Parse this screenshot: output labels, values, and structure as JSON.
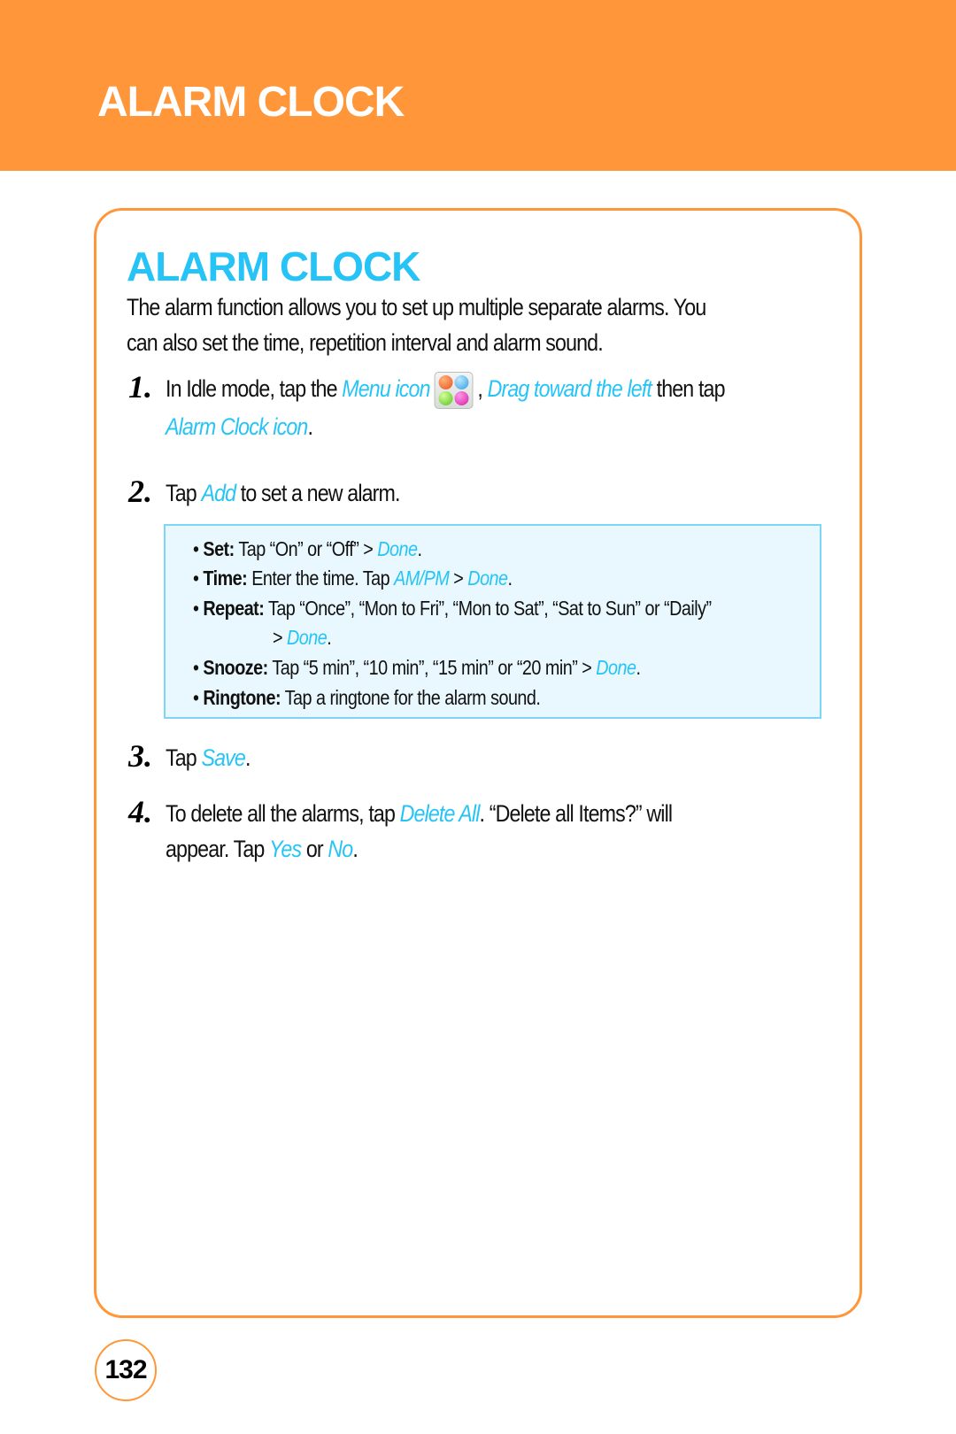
{
  "header": {
    "title": "ALARM CLOCK"
  },
  "section": {
    "title": "ALARM CLOCK",
    "intro_line1": "The alarm function allows you to set up multiple separate alarms. You",
    "intro_line2": "can also set the time, repetition interval and alarm sound."
  },
  "steps": [
    {
      "number": "1.",
      "parts": {
        "a": "In Idle mode, tap the ",
        "menu_icon_label": "Menu icon",
        "icon": "menu-grid-icon",
        "b": " , ",
        "drag": "Drag toward the left",
        "c": " then tap",
        "alarm_clock_icon": "Alarm Clock icon",
        "d": "."
      }
    },
    {
      "number": "2.",
      "parts": {
        "a": "Tap ",
        "add": "Add",
        "b": " to set a new alarm."
      }
    },
    {
      "number": "3.",
      "parts": {
        "a": "Tap ",
        "save": "Save",
        "b": "."
      }
    },
    {
      "number": "4.",
      "parts": {
        "a": "To delete all the alarms, tap ",
        "delete_all": "Delete All",
        "b": ". “Delete all Items?” will",
        "c": "appear. Tap ",
        "yes": "Yes",
        "d": " or ",
        "no": "No",
        "e": "."
      }
    }
  ],
  "options": [
    {
      "bullet": "• ",
      "label": "Set:",
      "text": " Tap “On” or “Off” > ",
      "link": "Done",
      "end": "."
    },
    {
      "bullet": "• ",
      "label": "Time:",
      "text": " Enter the time. Tap ",
      "link_ampm": "AM/PM",
      "text2": " > ",
      "link": "Done",
      "end": "."
    },
    {
      "bullet": "• ",
      "label": "Repeat:",
      "text": " Tap “Once”, “Mon to Fri”, “Mon to Sat”, “Sat to Sun” or “Daily”",
      "cont": "> ",
      "link": "Done",
      "end": "."
    },
    {
      "bullet": "• ",
      "label": "Snooze:",
      "text": " Tap “5 min”, “10 min”, “15 min” or “20 min” > ",
      "link": "Done",
      "end": "."
    },
    {
      "bullet": "• ",
      "label": "Ringtone:",
      "text": " Tap a ringtone for the alarm sound."
    }
  ],
  "page_number": "132",
  "colors": {
    "accent_orange": "#FF9639",
    "accent_cyan": "#26C4F6",
    "note_bg": "#E9F8FE",
    "note_border": "#7DD6F5"
  }
}
